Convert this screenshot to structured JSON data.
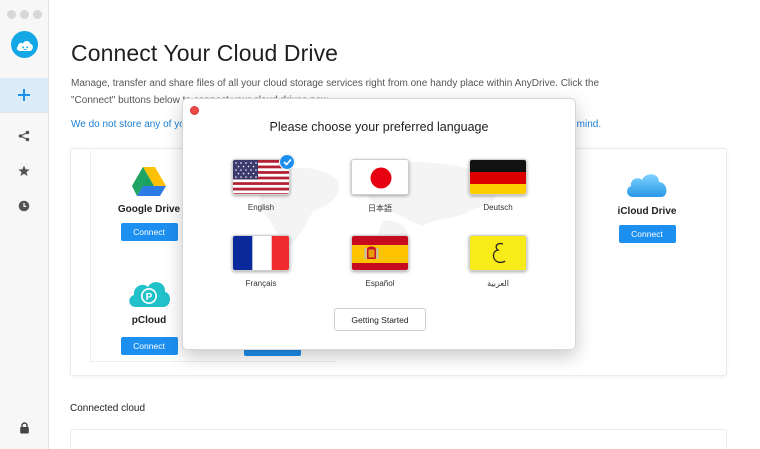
{
  "page": {
    "title": "Connect Your Cloud Drive",
    "description_line1": "Manage, transfer and share files of all your cloud storage services right from one handy place within AnyDrive. Click the",
    "description_line2": "\"Connect\" buttons below to connect your cloud drives now.",
    "notice_left": "We do not store any of yo",
    "notice_right": "ur mind.",
    "connected_label": "Connected cloud"
  },
  "services": [
    {
      "name": "Google Drive",
      "button": "Connect"
    },
    {
      "name": "iCloud Drive",
      "button": "Connect"
    },
    {
      "name": "pCloud",
      "button": "Connect"
    },
    {
      "name": "",
      "button": "Connect"
    }
  ],
  "dialog": {
    "title": "Please choose your preferred language",
    "languages": [
      {
        "label": "English",
        "selected": true
      },
      {
        "label": "日本語",
        "selected": false
      },
      {
        "label": "Deutsch",
        "selected": false
      },
      {
        "label": "Français",
        "selected": false
      },
      {
        "label": "Español",
        "selected": false
      },
      {
        "label": "العربية",
        "selected": false
      }
    ],
    "start_button": "Getting Started"
  },
  "colors": {
    "accent": "#1c8ff0",
    "link": "#1a7fd4",
    "logo": "#14a7e6",
    "close_dot": "#ef4a4a"
  }
}
